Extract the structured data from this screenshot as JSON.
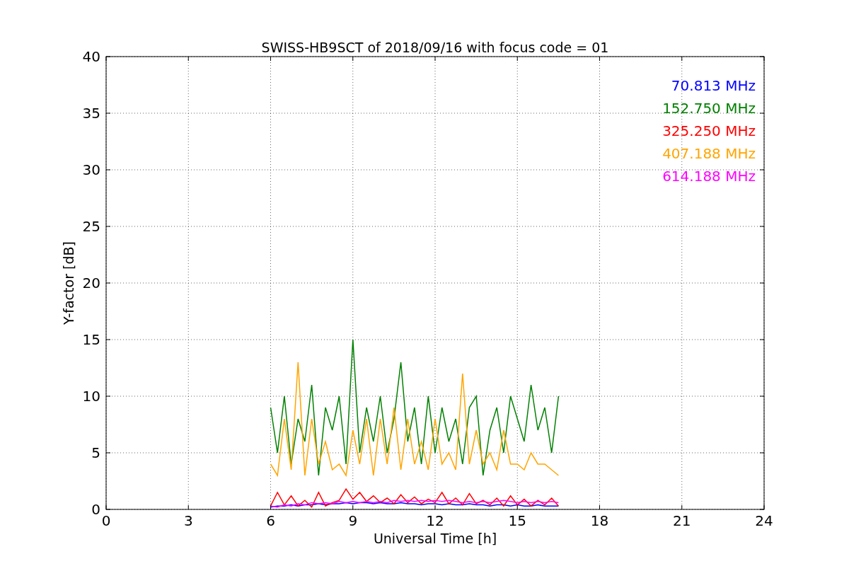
{
  "chart_data": {
    "type": "line",
    "title": "SWISS-HB9SCT of 2018/09/16 with focus code = 01",
    "xlabel": "Universal Time [h]",
    "ylabel": "Y-factor [dB]",
    "grid": true,
    "xlim": [
      0,
      24
    ],
    "ylim": [
      0,
      40
    ],
    "xticks": [
      0,
      3,
      6,
      9,
      12,
      15,
      18,
      21,
      24
    ],
    "yticks": [
      0,
      5,
      10,
      15,
      20,
      25,
      30,
      35,
      40
    ],
    "x": [
      6,
      6.25,
      6.5,
      6.75,
      7,
      7.25,
      7.5,
      7.75,
      8,
      8.25,
      8.5,
      8.75,
      9,
      9.25,
      9.5,
      9.75,
      10,
      10.25,
      10.5,
      10.75,
      11,
      11.25,
      11.5,
      11.75,
      12,
      12.25,
      12.5,
      12.75,
      13,
      13.25,
      13.5,
      13.75,
      14,
      14.25,
      14.5,
      14.75,
      15,
      15.25,
      15.5,
      15.75,
      16,
      16.25,
      16.5
    ],
    "series": [
      {
        "name": "70.813 MHz",
        "color": "#0000ff",
        "values": [
          0.2,
          0.3,
          0.3,
          0.4,
          0.3,
          0.4,
          0.4,
          0.5,
          0.4,
          0.5,
          0.5,
          0.6,
          0.5,
          0.6,
          0.6,
          0.5,
          0.6,
          0.5,
          0.5,
          0.6,
          0.5,
          0.5,
          0.4,
          0.5,
          0.5,
          0.4,
          0.5,
          0.4,
          0.4,
          0.5,
          0.4,
          0.4,
          0.3,
          0.4,
          0.4,
          0.3,
          0.4,
          0.3,
          0.3,
          0.4,
          0.3,
          0.3,
          0.3
        ]
      },
      {
        "name": "152.750 MHz",
        "color": "#008000",
        "values": [
          9,
          5,
          10,
          4,
          8,
          6,
          11,
          3,
          9,
          7,
          10,
          4,
          15,
          5,
          9,
          6,
          10,
          5,
          8,
          13,
          6,
          9,
          4,
          10,
          5,
          9,
          6,
          8,
          4,
          9,
          10,
          3,
          7,
          9,
          5,
          10,
          8,
          6,
          11,
          7,
          9,
          5,
          10
        ]
      },
      {
        "name": "325.250 MHz",
        "color": "#ff0000",
        "values": [
          0.3,
          1.5,
          0.4,
          1.2,
          0.3,
          0.8,
          0.2,
          1.5,
          0.3,
          0.6,
          0.8,
          1.8,
          0.9,
          1.5,
          0.7,
          1.2,
          0.6,
          1,
          0.5,
          1.3,
          0.6,
          1.1,
          0.5,
          0.9,
          0.6,
          1.5,
          0.5,
          1,
          0.4,
          1.4,
          0.5,
          0.8,
          0.4,
          1,
          0.3,
          1.2,
          0.4,
          0.9,
          0.3,
          0.8,
          0.4,
          1,
          0.3
        ]
      },
      {
        "name": "407.188 MHz",
        "color": "#ffa500",
        "values": [
          4,
          3,
          8,
          3.5,
          13,
          3,
          8,
          4,
          6,
          3.5,
          4,
          3,
          7,
          4,
          8,
          3,
          8,
          4,
          9,
          3.5,
          8,
          4,
          6,
          3.5,
          8,
          4,
          5,
          3.5,
          12,
          4,
          7,
          4,
          5,
          3.5,
          7,
          4,
          4,
          3.5,
          5,
          4,
          4,
          3.5,
          3
        ]
      },
      {
        "name": "614.188 MHz",
        "color": "#ff00ff",
        "values": [
          0.3,
          0.2,
          0.4,
          0.3,
          0.5,
          0.4,
          0.6,
          0.5,
          0.6,
          0.5,
          0.7,
          0.6,
          0.7,
          0.6,
          0.7,
          0.6,
          0.7,
          0.6,
          0.8,
          0.7,
          0.8,
          0.7,
          0.8,
          0.7,
          0.8,
          0.7,
          0.8,
          0.7,
          0.6,
          0.7,
          0.6,
          0.7,
          0.6,
          0.7,
          0.8,
          0.7,
          0.6,
          0.7,
          0.6,
          0.7,
          0.6,
          0.7,
          0.6
        ]
      }
    ]
  }
}
